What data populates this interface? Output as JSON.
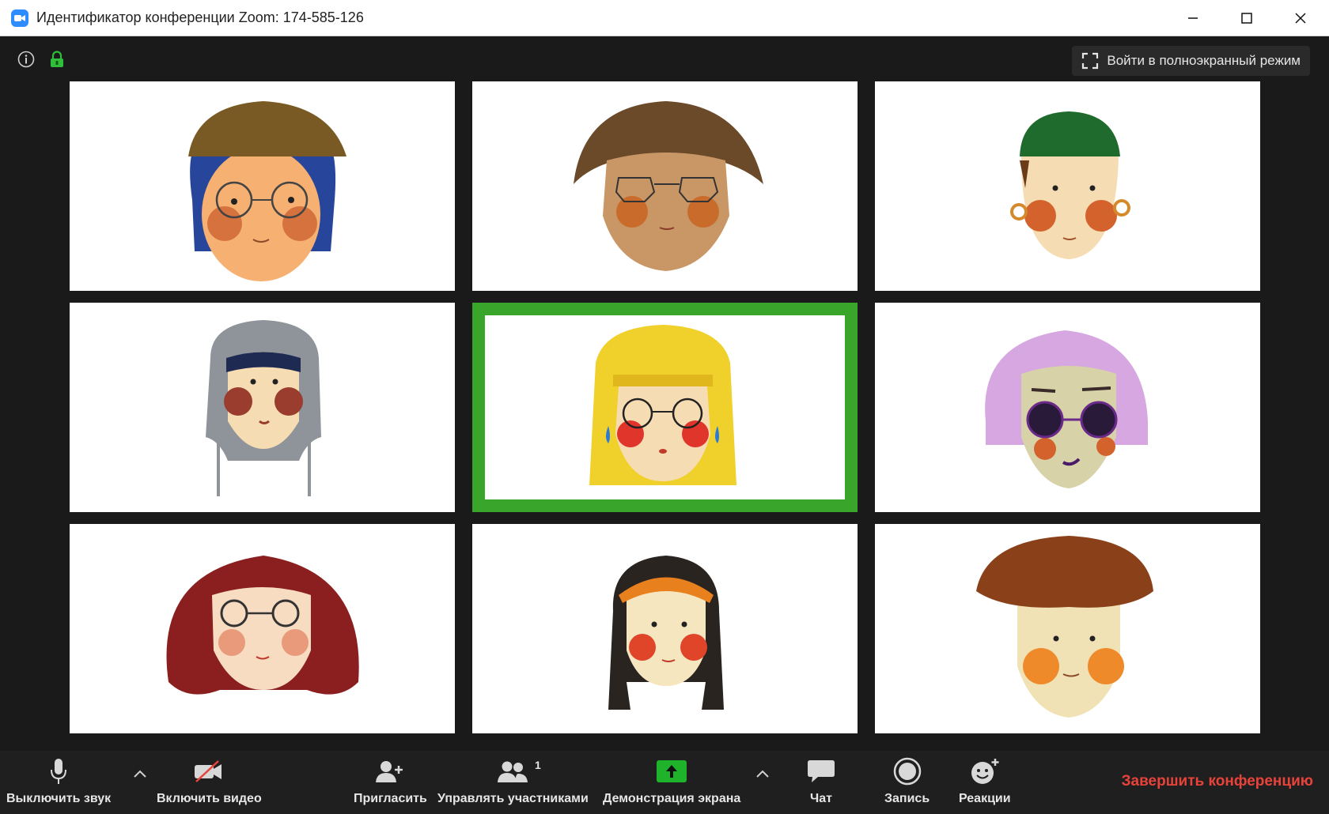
{
  "window": {
    "title": "Идентификатор конференции Zoom: 174-585-126"
  },
  "meeting": {
    "fullscreen_label": "Войти в полноэкранный режим",
    "participants": 9,
    "active_speaker": 5
  },
  "toolbar": {
    "mute_label": "Выключить звук",
    "video_label": "Включить видео",
    "invite_label": "Пригласить",
    "participants_label": "Управлять участниками",
    "participants_count": "1",
    "share_label": "Демонстрация экрана",
    "chat_label": "Чат",
    "record_label": "Запись",
    "reactions_label": "Реакции",
    "end_label": "Завершить конференцию"
  },
  "colors": {
    "accent_green": "#3aa52b",
    "zoom_blue": "#2d8cff",
    "end_red": "#e8433a",
    "share_green": "#1fb32b",
    "lock_green": "#2fbf3a"
  },
  "icons": [
    "info-icon",
    "lock-icon",
    "fullscreen-icon",
    "microphone-icon",
    "video-off-icon",
    "add-user-icon",
    "participants-icon",
    "share-screen-icon",
    "chat-icon",
    "record-icon",
    "reactions-icon",
    "caret-up-icon"
  ]
}
